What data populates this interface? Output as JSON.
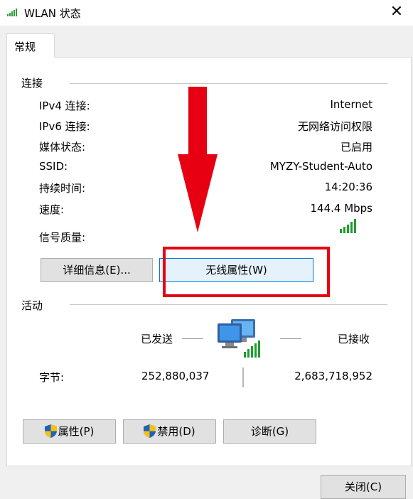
{
  "window": {
    "title": "WLAN 状态",
    "close_glyph": "✕"
  },
  "tabs": [
    {
      "label": "常规"
    }
  ],
  "connection": {
    "group_label": "连接",
    "rows": [
      {
        "label": "IPv4 连接:",
        "value": "Internet"
      },
      {
        "label": "IPv6 连接:",
        "value": "无网络访问权限"
      },
      {
        "label": "媒体状态:",
        "value": "已启用"
      },
      {
        "label": "SSID:",
        "value": "MYZY-Student-Auto"
      },
      {
        "label": "持续时间:",
        "value": "14:20:36"
      },
      {
        "label": "速度:",
        "value": "144.4 Mbps"
      }
    ],
    "signal_label": "信号质量:",
    "signal_bars": 5,
    "details_button": "详细信息(E)...",
    "wireless_props_button": "无线属性(W)"
  },
  "activity": {
    "group_label": "活动",
    "sent_label": "已发送",
    "received_label": "已接收",
    "bytes_label": "字节:",
    "bytes_sent": "252,880,037",
    "bytes_received": "2,683,718,952"
  },
  "buttons": {
    "properties": "属性(P)",
    "disable": "禁用(D)",
    "diagnose": "诊断(G)",
    "close": "关闭(C)"
  },
  "colors": {
    "annotation_red": "#e60012",
    "signal_green": "#1e9e2e",
    "focus_border": "#0078d7"
  },
  "icons": {
    "title": "wifi-signal-icon",
    "network": "network-computers-icon",
    "shield": "uac-shield-icon"
  }
}
